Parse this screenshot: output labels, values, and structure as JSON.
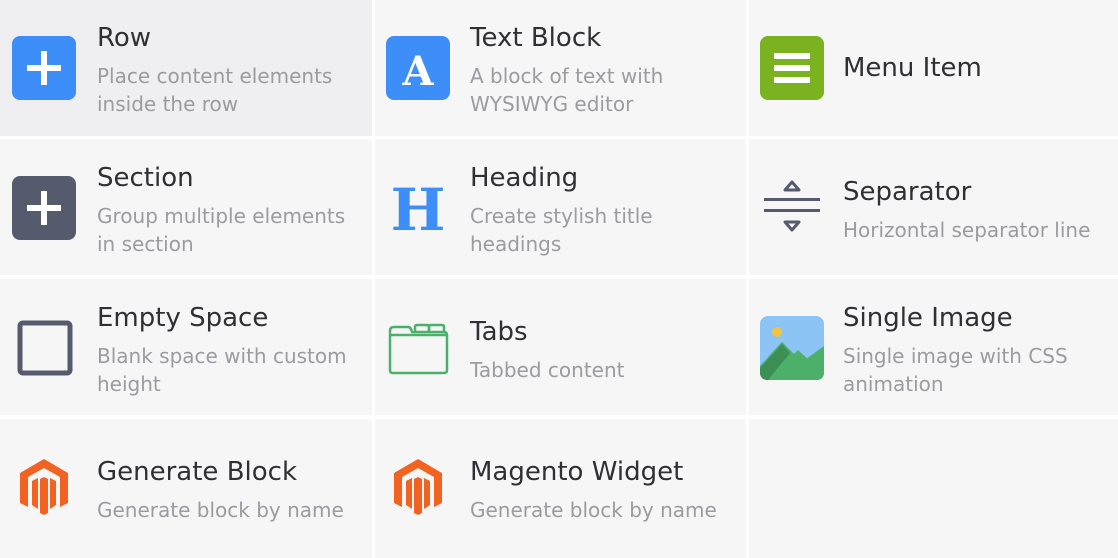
{
  "elements": [
    {
      "title": "Row",
      "desc1": "Place content elements",
      "desc2": "inside the row",
      "icon": "plus-square-icon",
      "color": "#3d8ef8"
    },
    {
      "title": "Text Block",
      "desc1": "A block of text with",
      "desc2": "WYSIWYG editor",
      "icon": "letter-a-icon",
      "color": "#3d8ef8"
    },
    {
      "title": "Menu Item",
      "desc1": "",
      "desc2": "",
      "icon": "menu-lines-icon",
      "color": "#7ab31f"
    },
    {
      "title": "Section",
      "desc1": "Group multiple elements",
      "desc2": "in section",
      "icon": "plus-square-icon",
      "color": "#555a6c"
    },
    {
      "title": "Heading",
      "desc1": "Create stylish title",
      "desc2": "headings",
      "icon": "letter-h-icon",
      "color": "#3d8ef8"
    },
    {
      "title": "Separator",
      "desc1": "Horizontal separator line",
      "desc2": "",
      "icon": "separator-icon",
      "color": "#555a6c"
    },
    {
      "title": "Empty Space",
      "desc1": "Blank space with custom",
      "desc2": "height",
      "icon": "empty-square-icon",
      "color": "#555a6c"
    },
    {
      "title": "Tabs",
      "desc1": "Tabbed content",
      "desc2": "",
      "icon": "tabs-icon",
      "color": "#4caf6a"
    },
    {
      "title": "Single Image",
      "desc1": "Single image with CSS",
      "desc2": "animation",
      "icon": "image-icon",
      "color": "#70aef0"
    },
    {
      "title": "Generate Block",
      "desc1": "Generate block by name",
      "desc2": "",
      "icon": "magento-icon",
      "color": "#f26322"
    },
    {
      "title": "Magento Widget",
      "desc1": "Generate block by name",
      "desc2": "",
      "icon": "magento-icon",
      "color": "#f26322"
    }
  ]
}
